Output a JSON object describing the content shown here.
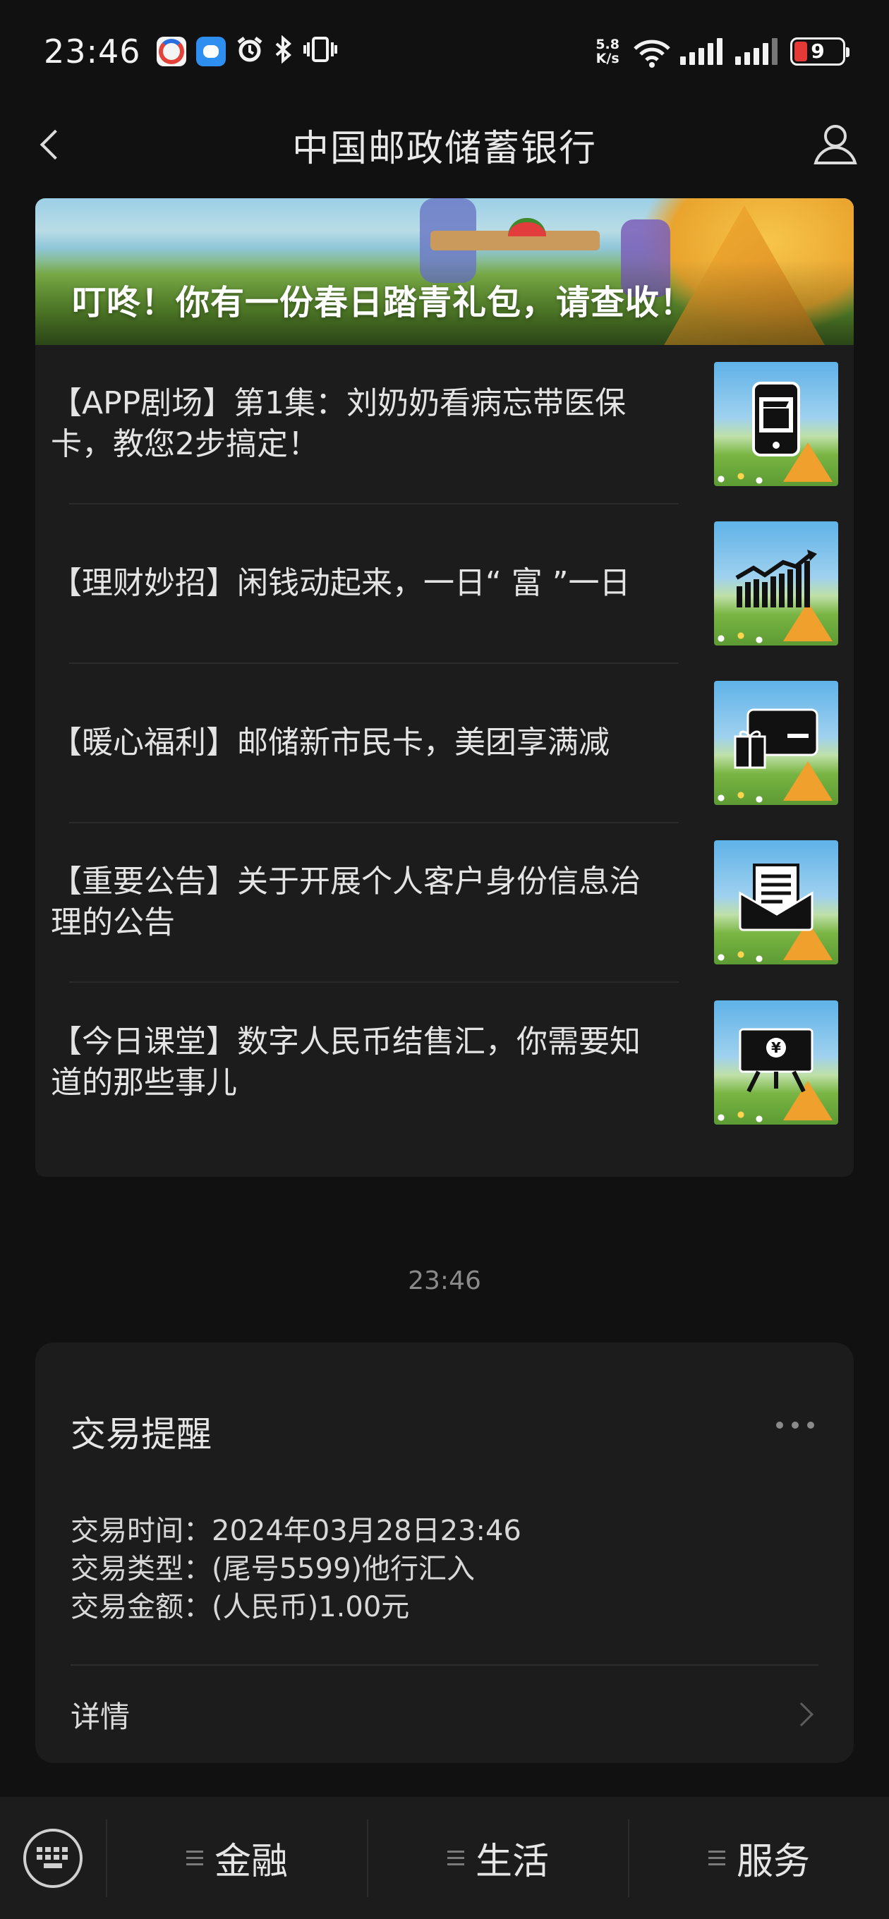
{
  "status_bar": {
    "time": "23:46",
    "net_speed_value": "5.8",
    "net_speed_unit": "K/s",
    "battery": "9",
    "icons": [
      "app-icon",
      "message-icon",
      "alarm-icon",
      "bluetooth-icon",
      "vibrate-icon",
      "wifi-icon",
      "signal-icon",
      "signal-icon",
      "battery-icon"
    ]
  },
  "header": {
    "title": "中国邮政储蓄银行"
  },
  "articles": {
    "banner_text": "叮咚！你有一份春日踏青礼包，请查收！",
    "items": [
      {
        "title": "【APP剧场】第1集：刘奶奶看病忘带医保卡，教您2步搞定！",
        "icon": "phone-clapper-icon"
      },
      {
        "title": "【理财妙招】闲钱动起来，一日“ 富 ”一日",
        "icon": "growth-chart-icon"
      },
      {
        "title": "【暖心福利】邮储新市民卡，美团享满减",
        "icon": "gift-card-icon"
      },
      {
        "title": "【重要公告】关于开展个人客户身份信息治理的公告",
        "icon": "envelope-document-icon"
      },
      {
        "title": "【今日课堂】数字人民币结售汇，你需要知道的那些事儿",
        "icon": "yuan-board-icon"
      }
    ]
  },
  "timestamp": "23:46",
  "transaction": {
    "title": "交易提醒",
    "line_time": "交易时间：2024年03月28日23:46",
    "line_type": "交易类型：(尾号5599)他行汇入",
    "line_amount": "交易金额：(人民币)1.00元",
    "detail_label": "详情"
  },
  "bottom_menu": {
    "items": [
      {
        "label": "金融"
      },
      {
        "label": "生活"
      },
      {
        "label": "服务"
      }
    ]
  },
  "colors": {
    "background": "#111111",
    "card": "#1c1c1c",
    "battery_low": "#e53935"
  }
}
